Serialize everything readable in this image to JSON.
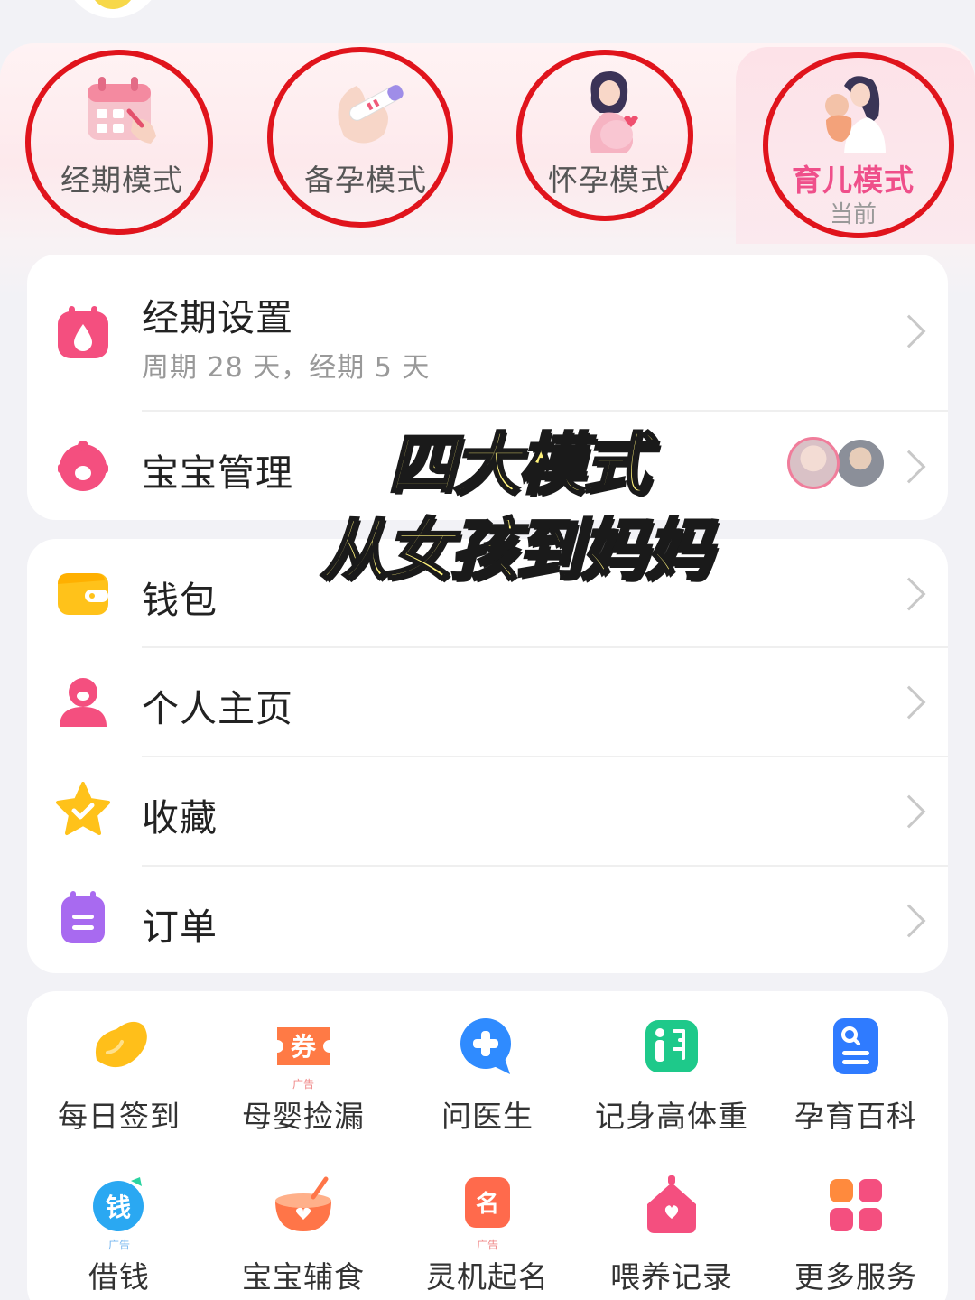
{
  "modes": [
    {
      "label": "经期模式",
      "art": "calendar-illustration"
    },
    {
      "label": "备孕模式",
      "art": "pregnancy-test-illustration"
    },
    {
      "label": "怀孕模式",
      "art": "pregnant-woman-illustration"
    },
    {
      "label": "育儿模式",
      "sub": "当前",
      "art": "mother-baby-illustration"
    }
  ],
  "settings_card": {
    "period": {
      "title": "经期设置",
      "subtitle": "周期 28 天，经期 5 天",
      "icon": "calendar-drop-icon"
    },
    "baby": {
      "title": "宝宝管理",
      "icon": "baby-face-icon"
    }
  },
  "overlay": {
    "line1": "四大模式",
    "line2": "从女孩到妈妈"
  },
  "menu_card": [
    {
      "label": "钱包",
      "icon": "wallet-icon"
    },
    {
      "label": "个人主页",
      "icon": "person-icon"
    },
    {
      "label": "收藏",
      "icon": "star-icon"
    },
    {
      "label": "订单",
      "icon": "order-icon"
    }
  ],
  "services": [
    {
      "label": "每日签到",
      "icon": "bean-icon",
      "ad": ""
    },
    {
      "label": "母婴捡漏",
      "icon": "coupon-icon",
      "ad": "广告",
      "glyph": "券"
    },
    {
      "label": "问医生",
      "icon": "doctor-chat-icon",
      "ad": ""
    },
    {
      "label": "记身高体重",
      "icon": "height-weight-icon",
      "ad": ""
    },
    {
      "label": "孕育百科",
      "icon": "encyclopedia-icon",
      "ad": ""
    },
    {
      "label": "借钱",
      "icon": "money-icon",
      "ad": "广告",
      "glyph": "钱"
    },
    {
      "label": "宝宝辅食",
      "icon": "baby-food-icon",
      "ad": ""
    },
    {
      "label": "灵机起名",
      "icon": "naming-icon",
      "ad": "广告",
      "glyph": "名"
    },
    {
      "label": "喂养记录",
      "icon": "feeding-house-icon",
      "ad": ""
    },
    {
      "label": "更多服务",
      "icon": "more-grid-icon",
      "ad": ""
    }
  ],
  "colors": {
    "accent": "#ef4f8a",
    "ring": "#e0141c",
    "overlay_text": "#fff27a"
  }
}
